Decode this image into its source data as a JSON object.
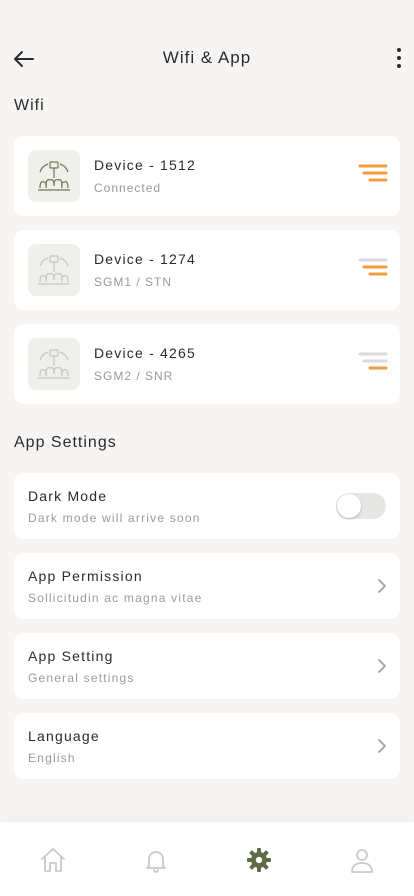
{
  "header": {
    "title": "Wifi & App",
    "back_icon": "arrow-left-icon",
    "menu_icon": "more-vertical-icon"
  },
  "wifi": {
    "section_title": "Wifi",
    "devices": [
      {
        "name": "Device - 1512",
        "status": "Connected",
        "active": true
      },
      {
        "name": "Device - 1274",
        "status": "SGM1 / STN",
        "active": false
      },
      {
        "name": "Device - 4265",
        "status": "SGM2 / SNR",
        "active": false
      }
    ]
  },
  "app_settings": {
    "section_title": "App Settings",
    "items": [
      {
        "label": "Dark Mode",
        "desc": "Dark mode will arrive soon",
        "control": "toggle",
        "enabled": false
      },
      {
        "label": "App Permission",
        "desc": "Sollicitudin ac magna vitae",
        "control": "chevron"
      },
      {
        "label": "App Setting",
        "desc": "General settings",
        "control": "chevron"
      },
      {
        "label": "Language",
        "desc": "English",
        "control": "chevron"
      }
    ]
  },
  "tabbar": {
    "tabs": [
      {
        "icon": "home-icon",
        "active": false
      },
      {
        "icon": "bell-icon",
        "active": false
      },
      {
        "icon": "gear-icon",
        "active": true
      },
      {
        "icon": "user-icon",
        "active": false
      }
    ]
  },
  "colors": {
    "accent": "#f39c3d",
    "active_tab": "#5f6b45",
    "icon_gray": "#c9c9c9",
    "device_line": "#6e7a4e"
  }
}
